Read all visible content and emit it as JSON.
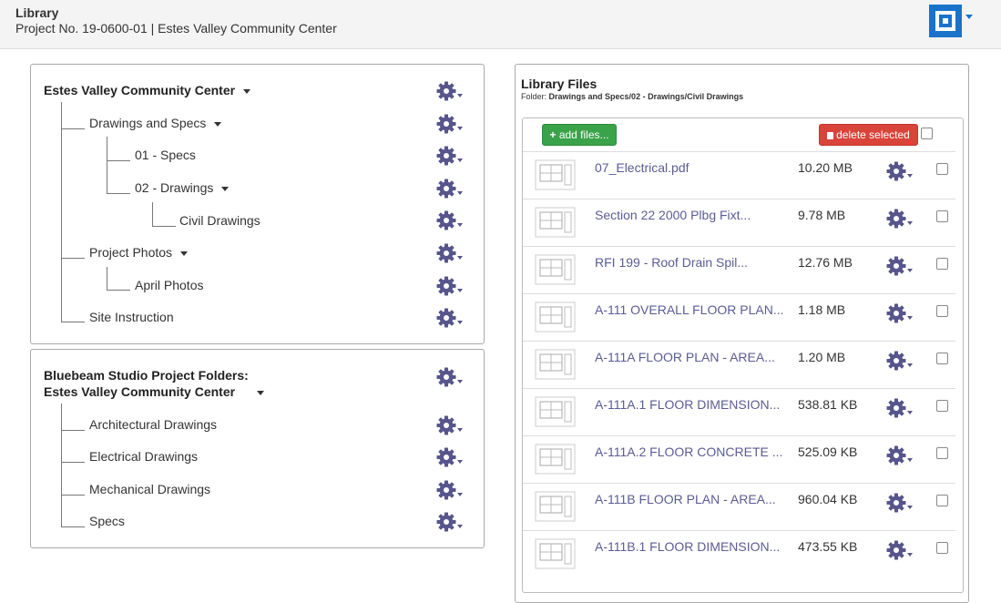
{
  "header": {
    "title": "Library",
    "subtitle": "Project No. 19-0600-01 | Estes Valley Community Center",
    "accent_color": "#1a73c9"
  },
  "tree1": {
    "title": "Estes Valley Community Center",
    "nodes": [
      {
        "label": "Drawings and Specs"
      },
      {
        "label": "01 - Specs"
      },
      {
        "label": "02 - Drawings"
      },
      {
        "label": "Civil Drawings"
      },
      {
        "label": "Project Photos"
      },
      {
        "label": "April Photos"
      },
      {
        "label": "Site Instruction"
      }
    ]
  },
  "tree2": {
    "title_line1": "Bluebeam Studio Project Folders:",
    "title_line2": "Estes Valley Community Center",
    "nodes": [
      {
        "label": "Architectural Drawings"
      },
      {
        "label": "Electrical Drawings"
      },
      {
        "label": "Mechanical Drawings"
      },
      {
        "label": "Specs"
      }
    ]
  },
  "library": {
    "title": "Library Files",
    "folder_label": "Folder:",
    "folder_path": "Drawings and Specs/02 - Drawings/Civil Drawings",
    "add_label": "add files...",
    "delete_label": "delete selected",
    "files": [
      {
        "name": "07_Electrical.pdf",
        "size": "10.20 MB"
      },
      {
        "name": "Section 22 2000 Plbg Fixt...",
        "size": "9.78 MB"
      },
      {
        "name": "RFI 199 - Roof Drain Spil...",
        "size": "12.76 MB"
      },
      {
        "name": "A-111 OVERALL FLOOR PLAN...",
        "size": "1.18 MB"
      },
      {
        "name": "A-111A FLOOR PLAN - AREA...",
        "size": "1.20 MB"
      },
      {
        "name": "A-111A.1 FLOOR DIMENSION...",
        "size": "538.81 KB"
      },
      {
        "name": "A-111A.2 FLOOR CONCRETE ...",
        "size": "525.09 KB"
      },
      {
        "name": "A-111B FLOOR PLAN - AREA...",
        "size": "960.04 KB"
      },
      {
        "name": "A-111B.1 FLOOR DIMENSION...",
        "size": "473.55 KB"
      }
    ]
  }
}
